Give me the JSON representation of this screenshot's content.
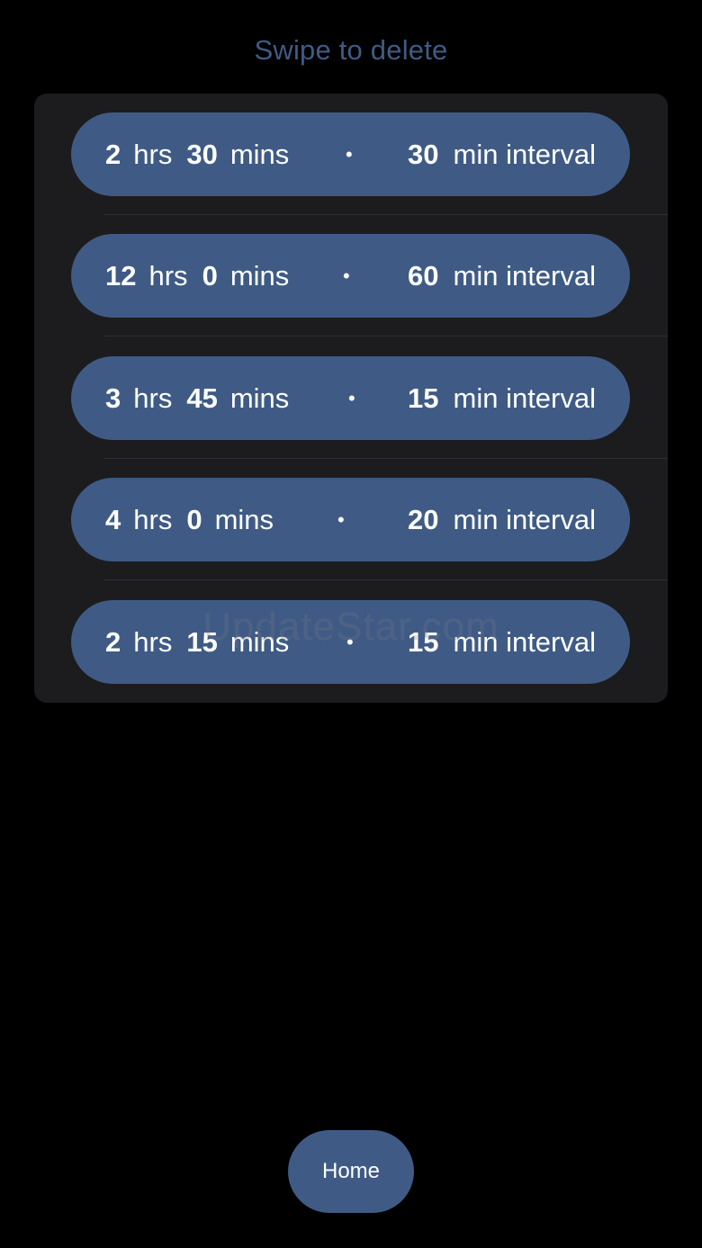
{
  "hint": "Swipe to delete",
  "units": {
    "hours": "hrs",
    "minutes": "mins",
    "separator": "•",
    "interval_suffix": "min interval"
  },
  "timers": [
    {
      "hours": "2",
      "minutes": "30",
      "interval": "30"
    },
    {
      "hours": "12",
      "minutes": "0",
      "interval": "60"
    },
    {
      "hours": "3",
      "minutes": "45",
      "interval": "15"
    },
    {
      "hours": "4",
      "minutes": "0",
      "interval": "20"
    },
    {
      "hours": "2",
      "minutes": "15",
      "interval": "15"
    }
  ],
  "watermark": "UpdateStar.com",
  "home_button": {
    "label": "Home"
  },
  "colors": {
    "background": "#000000",
    "card": "#1c1c1e",
    "accent": "#3f5b85",
    "text": "#ffffff"
  }
}
